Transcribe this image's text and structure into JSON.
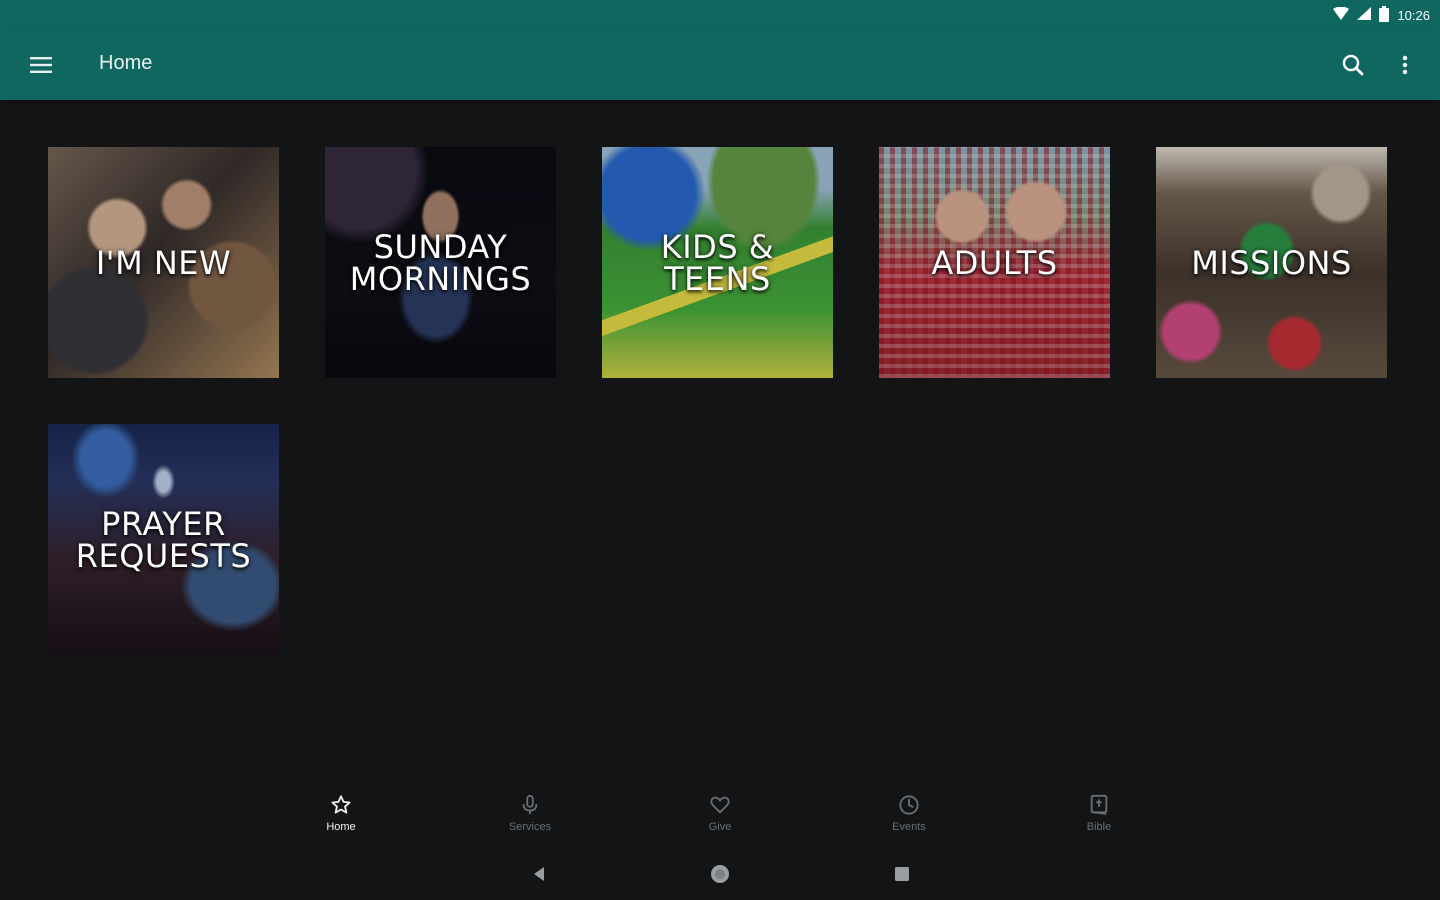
{
  "status_bar": {
    "time": "10:26",
    "icons": [
      "wifi-icon",
      "signal-icon",
      "battery-icon"
    ]
  },
  "app_bar": {
    "title": "Home",
    "left_icon": "hamburger-menu-icon",
    "right_icons": [
      "search-icon",
      "more-vert-icon"
    ],
    "color": "#0f6760"
  },
  "tiles": [
    {
      "label": "I'M NEW"
    },
    {
      "label": "SUNDAY\nMORNINGS"
    },
    {
      "label": "KIDS & TEENS"
    },
    {
      "label": "ADULTS"
    },
    {
      "label": "MISSIONS"
    },
    {
      "label": "PRAYER\nREQUESTS"
    }
  ],
  "bottom_nav": {
    "items": [
      {
        "label": "Home",
        "icon": "star-icon",
        "active": true
      },
      {
        "label": "Services",
        "icon": "microphone-icon",
        "active": false
      },
      {
        "label": "Give",
        "icon": "heart-icon",
        "active": false
      },
      {
        "label": "Events",
        "icon": "clock-icon",
        "active": false
      },
      {
        "label": "Bible",
        "icon": "bible-icon",
        "active": false
      }
    ]
  },
  "system_nav": [
    "back-icon",
    "home-circle-icon",
    "recents-icon"
  ],
  "colors": {
    "background": "#121416",
    "accent": "#0f6760",
    "inactive_nav": "#6b6f72"
  }
}
